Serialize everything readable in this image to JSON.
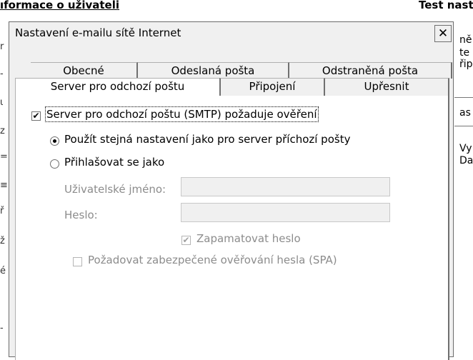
{
  "background_window": {
    "title_left": "ıformace o uživateli",
    "title_right": "Test nast",
    "right_fragments": [
      "ně",
      "te",
      "řip",
      "as",
      "Vy",
      "Da"
    ],
    "left_fragments": [
      "r",
      "-",
      "ι",
      "z",
      "=",
      "≡",
      "ř",
      "ž",
      "é",
      "-"
    ]
  },
  "dialog": {
    "title": "Nastavení e-mailu sítě Internet",
    "close_label": "✕",
    "tabs_row1": [
      "Obecné",
      "Odeslaná pošta",
      "Odstraněná pošta"
    ],
    "tabs_row2": [
      "Server pro odchozí poštu",
      "Připojení",
      "Upřesnit"
    ],
    "active_tab": "Server pro odchozí poštu",
    "smtp_auth": {
      "label": "Server pro odchozí poštu (SMTP) požaduje ověření",
      "checked": true
    },
    "radio_same": {
      "label": "Použít stejná nastavení jako pro server příchozí pošty",
      "selected": true
    },
    "radio_login": {
      "label": "Přihlašovat se jako",
      "selected": false
    },
    "username": {
      "label": "Uživatelské jméno:",
      "value": ""
    },
    "password": {
      "label": "Heslo:",
      "value": ""
    },
    "remember": {
      "label": "Zapamatovat heslo",
      "checked": true,
      "disabled": true
    },
    "spa": {
      "label": "Požadovat zabezpečené ověřování hesla (SPA)",
      "checked": false,
      "disabled": true
    },
    "check_mark": "✔"
  }
}
